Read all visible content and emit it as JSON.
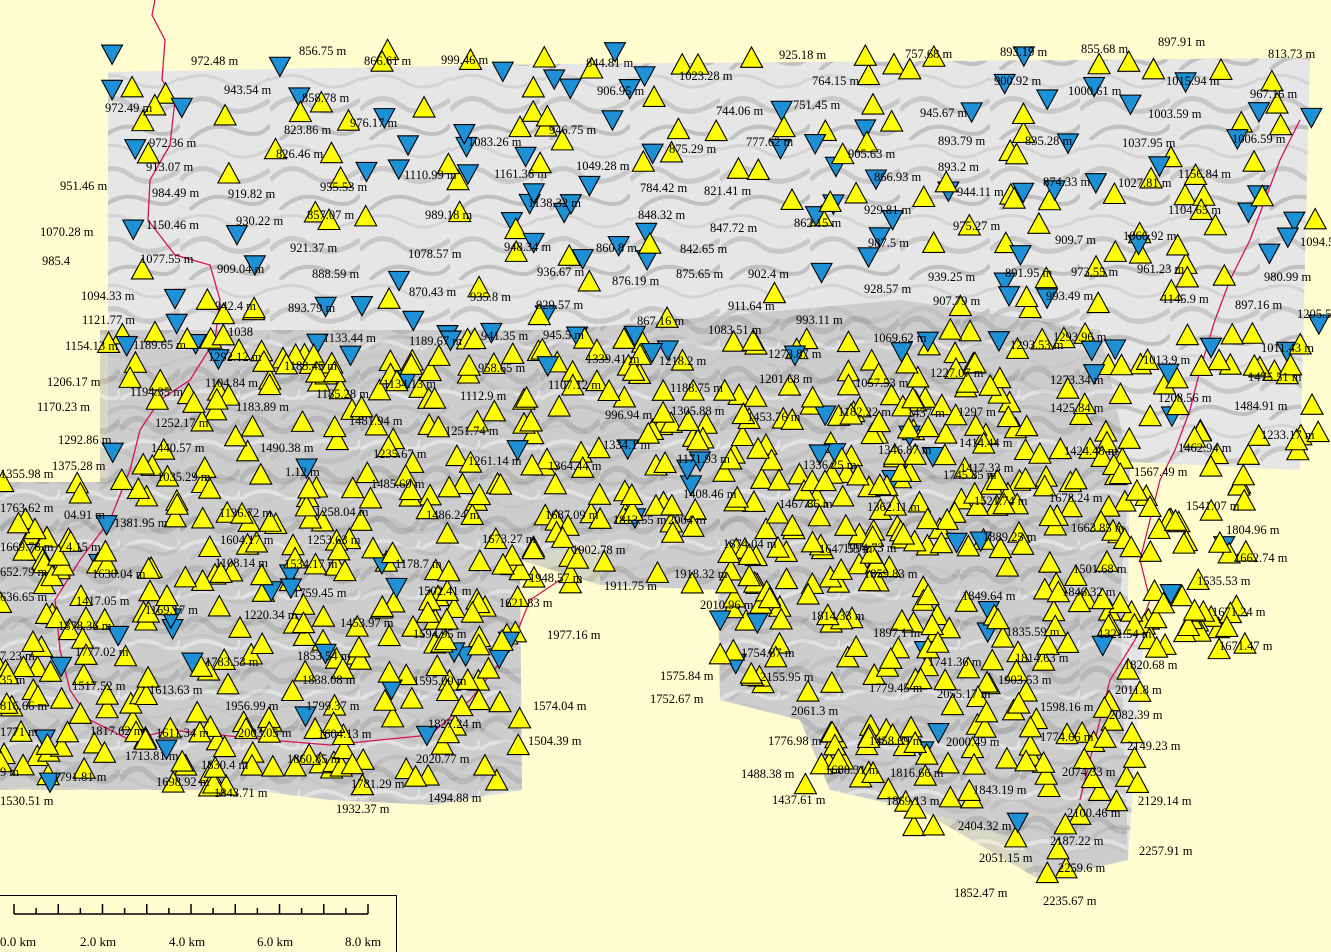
{
  "colors": {
    "background": "#fffdd0",
    "relief_light": "#e9e9e9",
    "relief_dark": "#9a9a9a",
    "boundary_line": "#d4145a",
    "up_marker": "#ffff00",
    "down_marker": "#1e90d6",
    "marker_outline": "#000000"
  },
  "symbols": {
    "up_marker_icon": "yellow-triangle-up-icon",
    "down_marker_icon": "blue-triangle-down-icon"
  },
  "labels": [
    "972.48 m",
    "856.75 m",
    "866.61 m",
    "999.46 m",
    "844.81 m",
    "925.18 m",
    "757.68 m",
    "893.19 m",
    "855.68 m",
    "897.91 m",
    "813.73 m",
    "943.54 m",
    "858.78 m",
    "976.17 m",
    "1023.28 m",
    "764.15 m",
    "900.92 m",
    "1000.61 m",
    "1015.94 m",
    "967.16 m",
    "972.49 m",
    "823.86 m",
    "906.95 m",
    "744.06 m",
    "751.45 m",
    "945.67 m",
    "1003.59 m",
    "972.36 m",
    "826.46 m",
    "1083.26 m",
    "946.75 m",
    "875.29 m",
    "777.62 m",
    "905.63 m",
    "893.79 m",
    "835.28 m",
    "1037.95 m",
    "1006.59 m",
    "913.07 m",
    "1110.99 m",
    "1161.36 m",
    "1049.28 m",
    "893.2 m",
    "874.33 m",
    "1027.81 m",
    "1156.84 m",
    "951.46 m",
    "984.49 m",
    "955.53 m",
    "784.42 m",
    "821.41 m",
    "866.93 m",
    "944.11 m",
    "919.82 m",
    "1138.32 m",
    "929.81 m",
    "1104.65 m",
    "930.22 m",
    "857.07 m",
    "989.18 m",
    "848.32 m",
    "847.72 m",
    "862.15 m",
    "975.27 m",
    "1070.28 m",
    "1150.46 m",
    "921.37 m",
    "948.34 m",
    "860.8 m",
    "842.65 m",
    "987.5 m",
    "909.7 m",
    "1066.92 m",
    "1094.5 m",
    "985.4",
    "1077.55 m",
    "1078.57 m",
    "909.04 m",
    "888.59 m",
    "936.67 m",
    "876.19 m",
    "875.65 m",
    "902.4 m",
    "891.95 m",
    "973.55 m",
    "961.23 m",
    "980.99 m",
    "939.25 m",
    "1094.33 m",
    "870.43 m",
    "935.8 m",
    "929.57 m",
    "928.57 m",
    "993.49 m",
    "1145.9 m",
    "897.16 m",
    "942.4 m",
    "893.79 m",
    "911.64 m",
    "907.79 m",
    "1121.77 m",
    "867.16 m",
    "993.11 m",
    "1205.58 m",
    "1038",
    "1133.44 m",
    "1083.51 m",
    "1154.13 m",
    "1189.65 m",
    "1189.67 m",
    "941.35 m",
    "945.5 m",
    "1069.62 m",
    "1293.96 m",
    "1293.53 m",
    "1292.12 m",
    "1183.45 m",
    "958.65 m",
    "1339.41 m",
    "1218.2 m",
    "1273.87 m",
    "1011.43 m",
    "1013.9 m",
    "1206.17 m",
    "1104.84 m",
    "1134.13 m",
    "1107.12 m",
    "1188.75 m",
    "1201.68 m",
    "1057.53 m",
    "1227.07 m",
    "1273.34 m",
    "1475.51 m",
    "1194.35 m",
    "1185.28 m",
    "1112.9 m",
    "1208.56 m",
    "1170.23 m",
    "1183.89 m",
    "996.94 m",
    "1305.88 m",
    "1453.76 m",
    "1182.22 m",
    "1437 m",
    "1297 m",
    "1425.84 m",
    "1484.91 m",
    "1252.17 m",
    "1481.94 m",
    "1251.74 m",
    "1233.17 m",
    "1292.86 m",
    "1440.57 m",
    "1490.38 m",
    "1235.67 m",
    "1334.1 m",
    "1346.87 m",
    "1414.44 m",
    "1462.94 m",
    "1375.28 m",
    "1261.14 m",
    "1171.93 m",
    "1336.25 m",
    "1424.48 m",
    "1355.98 m",
    "1.12 m",
    "1364.44 m",
    "1745.85 m",
    "1417.33 m",
    "1567.49 m",
    "1035.29 m",
    "1485.69 m",
    "1408.46 m",
    "1467.86 m",
    "1362.11 m",
    "1521.74 m",
    "1678.24 m",
    "1763.62 m",
    "04.91 m",
    "1136.72 m",
    "1258.04 m",
    "1486.24 m",
    "1687.09 m",
    "1813.55 m",
    "2004 m",
    "1541.07 m",
    "1381.95 m",
    "1663.85 m",
    "1804.96 m",
    "1669.78 m",
    "4.15 m",
    "1604.17 m",
    "1253.63 m",
    "1673.27 m",
    "1874.04 m",
    "1647.53 m",
    "1889.25 m",
    "1108.14 m",
    "1534.17 m",
    "1178.7 m",
    "1902.78 m",
    "1994.73 m",
    "1662.74 m",
    "652.79 m",
    "1630.04 m",
    "1948.57 m",
    "1911.75 m",
    "1918.32 m",
    "1859.83 m",
    "1501.68 m",
    "1535.53 m",
    "1502.41 m",
    "1759.45 m",
    "1621.83 m",
    "1849.64 m",
    "1846.32 m",
    "636.65 m",
    "1417.05 m",
    "1169.17 m",
    "2010.96 m",
    "1671.24 m",
    "1220.34 m",
    "1453.97 m",
    "1594.95 m",
    "1814.33 m",
    "1977.16 m",
    "1878.36 m",
    "1897.1 m",
    "1835.59 m",
    "1321.54 m",
    "1671.47 m",
    "1777.02 m",
    "1853.54 m",
    "1741.36 m",
    "1814.63 m",
    "7.23 m",
    "1783.53 m",
    "1754.87 m",
    "1820.68 m",
    "1575.84 m",
    "2155.95 m",
    "1838.08 m",
    "1595.09 m",
    "35 m",
    "1517.52 m",
    "1613.63 m",
    "1779.45 m",
    "2055.17 m",
    "1903.53 m",
    "2011.8 m",
    "1752.67 m",
    "1574.04 m",
    "816.66 m",
    "1956.99 m",
    "1799.37 m",
    "2061.3 m",
    "1598.16 m",
    "2082.39 m",
    "2003.05 m",
    "1827.24 m",
    "1604.13 m",
    "1458.69 m",
    "2000.49 m",
    "1774.66 m",
    "1771 m",
    "1817.62 m",
    "1611.34 m",
    "1504.39 m",
    "1776.98 m",
    "2149.23 m",
    "1713.81 m",
    "1830.4 m",
    "1860.85 m",
    "2020.77 m",
    "1688.31 m",
    "1816.66 m",
    "2074.33 m",
    "9 m",
    "1791.81 m",
    "1698.92 m",
    "1781.29 m",
    "1488.38 m",
    "1843.19 m",
    "1843.71 m",
    "1494.88 m",
    "1932.37 m",
    "1437.61 m",
    "1869.13 m",
    "2129.14 m",
    "1530.51 m",
    "2100.46 m",
    "2404.32 m",
    "2187.22 m",
    "2051.15 m",
    "2257.91 m",
    "2259.6 m",
    "1852.47 m",
    "2235.67 m"
  ],
  "scale_bar": {
    "tick_labels": [
      "0.0 km",
      "2.0 km",
      "4.0 km",
      "6.0 km",
      "8.0 km"
    ]
  }
}
